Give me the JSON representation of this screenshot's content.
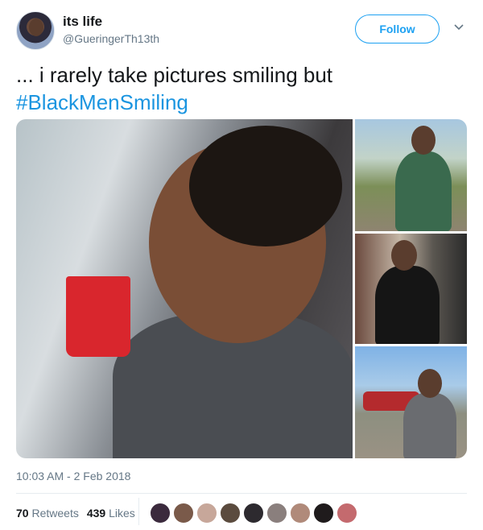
{
  "user": {
    "display_name": "its life",
    "handle": "@GueringerTh13th"
  },
  "follow_label": "Follow",
  "tweet": {
    "text": "... i rarely take pictures smiling but",
    "hashtag": "#BlackMenSmiling"
  },
  "timestamp": "10:03 AM - 2 Feb 2018",
  "stats": {
    "retweets_count": "70",
    "retweets_label": "Retweets",
    "likes_count": "439",
    "likes_label": "Likes"
  },
  "colors": {
    "accent": "#1da1f2",
    "hashtag": "#1b95e0",
    "muted": "#657786"
  },
  "likers": [
    "#3b2a3d",
    "#7a5a4a",
    "#c7a79a",
    "#5b4b3e",
    "#2d2a2f",
    "#8a7f7d",
    "#b08a7a",
    "#1f1b1c",
    "#c46a6e"
  ]
}
